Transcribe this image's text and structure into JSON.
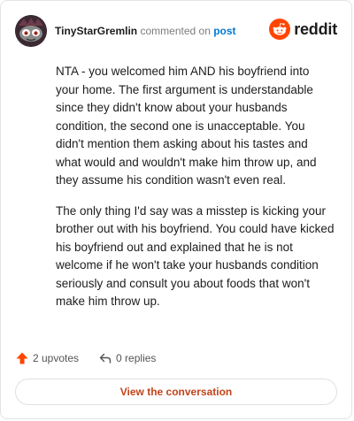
{
  "header": {
    "username": "TinyStarGremlin",
    "action_text": "commented on",
    "post_link": "post",
    "brand_name": "reddit",
    "brand_color": "#ff4500"
  },
  "comment": {
    "paragraphs": [
      "NTA - you welcomed him AND his boyfriend into your home. The first argument is understandable since they didn't know about your husbands condition, the second one is unacceptable. You didn't mention them asking about his tastes and what would and wouldn't make him throw up, and they assume his condition wasn't even real.",
      "The only thing I'd say was a misstep is kicking your brother out with his boyfriend. You could have kicked his boyfriend out and explained that he is not welcome if he won't take your husbands condition seriously and consult you about foods that won't make him throw up."
    ]
  },
  "footer": {
    "upvotes": "2 upvotes",
    "replies": "0 replies",
    "upvote_icon": "upvote-arrow-icon",
    "reply_icon": "reply-arrow-icon",
    "upvote_color": "#ff4500"
  },
  "cta": {
    "label": "View the conversation"
  }
}
